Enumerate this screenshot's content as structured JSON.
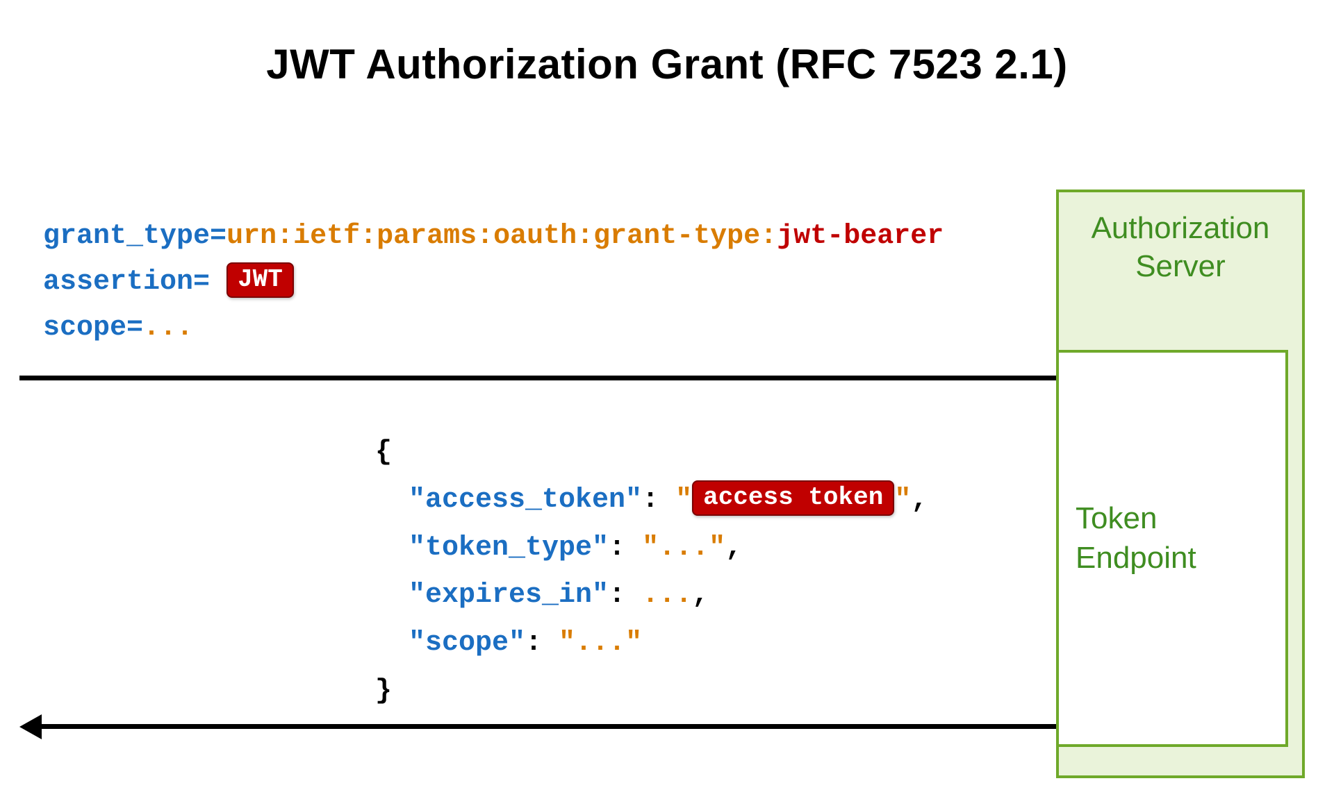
{
  "title": "JWT Authorization Grant (RFC 7523 2.1)",
  "request": {
    "grant_type_key": "grant_type",
    "equals": "=",
    "grant_type_urn": "urn:ietf:params:oauth:grant-type:",
    "grant_type_tail": "jwt-bearer",
    "assertion_key": "assertion",
    "assertion_badge": "JWT",
    "scope_key": "scope",
    "scope_value": "..."
  },
  "response": {
    "open_brace": "{",
    "close_brace": "}",
    "access_token_key": "\"access_token\"",
    "colon_sp": ": ",
    "quote": "\"",
    "access_token_badge": "access token",
    "comma": ",",
    "token_type_key": "\"token_type\"",
    "token_type_val": "\"...\"",
    "expires_in_key": "\"expires_in\"",
    "expires_in_val": "...",
    "scope_key": "\"scope\"",
    "scope_val": "\"...\""
  },
  "boxes": {
    "auth_server_line1": "Authorization",
    "auth_server_line2": "Server",
    "token_endpoint_line1": "Token",
    "token_endpoint_line2": "Endpoint"
  }
}
